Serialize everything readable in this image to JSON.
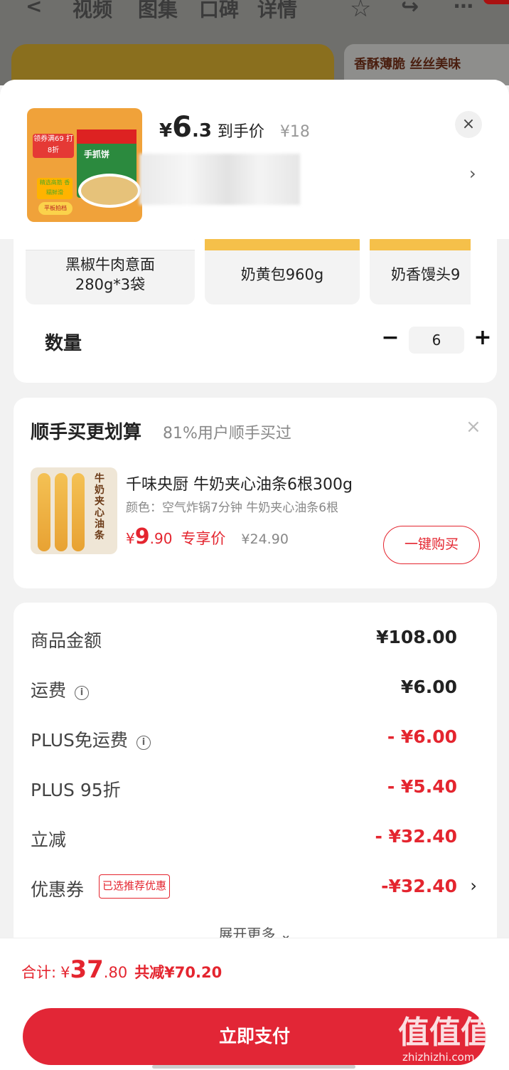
{
  "nav": {
    "back": "<",
    "tabs": [
      "视频",
      "图集",
      "口碑",
      "详情"
    ],
    "banner_text": "香酥薄脆 丝丝美味"
  },
  "header": {
    "price_yen": "¥",
    "price_int": "6",
    "price_dec": ".3",
    "price_tag": "到手价",
    "original_price": "¥18",
    "close": "×",
    "chevron": "›",
    "thumb": {
      "tag1": "领券满69 打8折",
      "bag_text": "手抓饼",
      "tag2": "精选高筋 香糯鲜滑",
      "tag3": "平板拍档"
    }
  },
  "spec": {
    "items": [
      {
        "label": "黑椒牛肉意面\n280g*3袋"
      },
      {
        "label": "奶黄包960g"
      },
      {
        "label": "奶香馒头9"
      }
    ],
    "quantity_label": "数量",
    "minus": "−",
    "plus": "+",
    "quantity": "6"
  },
  "recommend": {
    "title": "顺手买更划算",
    "subtitle": "81%用户顺手买过",
    "close": "×",
    "product_name": "千味央厨 牛奶夹心油条6根300g",
    "attr": "颜色：空气炸锅7分钟 牛奶夹心油条6根",
    "price_yen": "¥",
    "price_int": "9",
    "price_dec": ".90",
    "price_tag": "专享价",
    "original_price": "¥24.90",
    "buy_label": "一键购买",
    "img_text": "牛奶夹心油条"
  },
  "summary": {
    "rows": [
      {
        "label": "商品金额",
        "value": "¥108.00"
      },
      {
        "label": "运费",
        "value": "¥6.00"
      },
      {
        "label": "PLUS免运费",
        "value": "- ¥6.00"
      },
      {
        "label": "PLUS 95折",
        "value": "- ¥5.40"
      },
      {
        "label": "立减",
        "value": "- ¥32.40"
      },
      {
        "label": "优惠券",
        "value": "-¥32.40"
      }
    ],
    "info_icon": "i",
    "coupon_badge": "已选推荐优惠",
    "coupon_chevron": "›",
    "expand": "展开更多 ⌄"
  },
  "footer": {
    "total_label": "合计:",
    "total_yen": "¥",
    "total_int": "37",
    "total_dec": ".80",
    "saved": "共减¥70.20",
    "pay_label": "立即支付",
    "watermark": "值",
    "watermark_site": "zhizhizhi.com"
  },
  "colors": {
    "accent_red": "#e4252f",
    "pay_button": "#e22636"
  }
}
